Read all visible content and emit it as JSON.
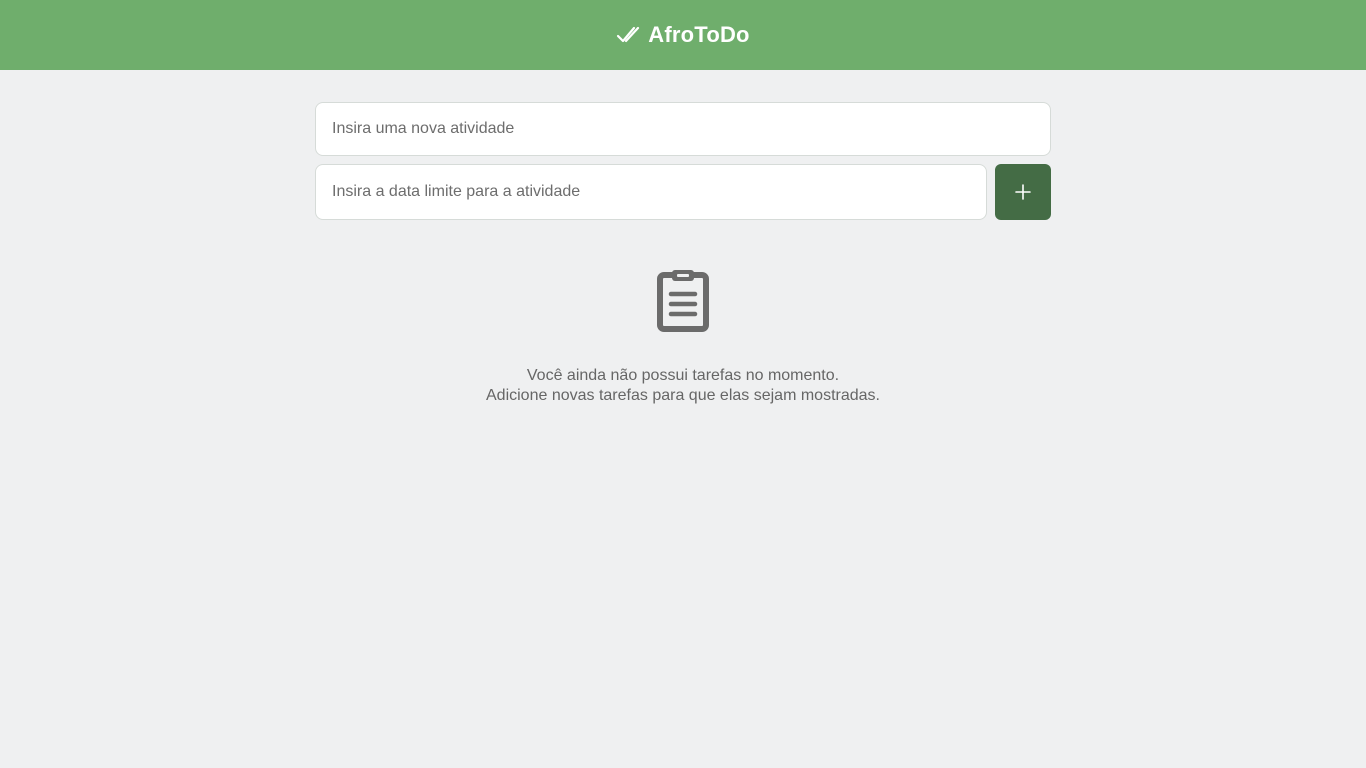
{
  "header": {
    "title": "AfroToDo",
    "logo_icon": "double-check-icon",
    "background_color": "#6fae6c"
  },
  "form": {
    "task_placeholder": "Insira uma nova atividade",
    "task_value": "",
    "date_placeholder": "Insira a data limite para a atividade",
    "date_value": "",
    "add_button_icon": "plus-icon",
    "add_button_color": "#446c45"
  },
  "empty_state": {
    "icon": "clipboard-icon",
    "line1": "Você ainda não possui tarefas no momento.",
    "line2": "Adicione novas tarefas para que elas sejam mostradas."
  },
  "page": {
    "background_color": "#eff0f1"
  }
}
